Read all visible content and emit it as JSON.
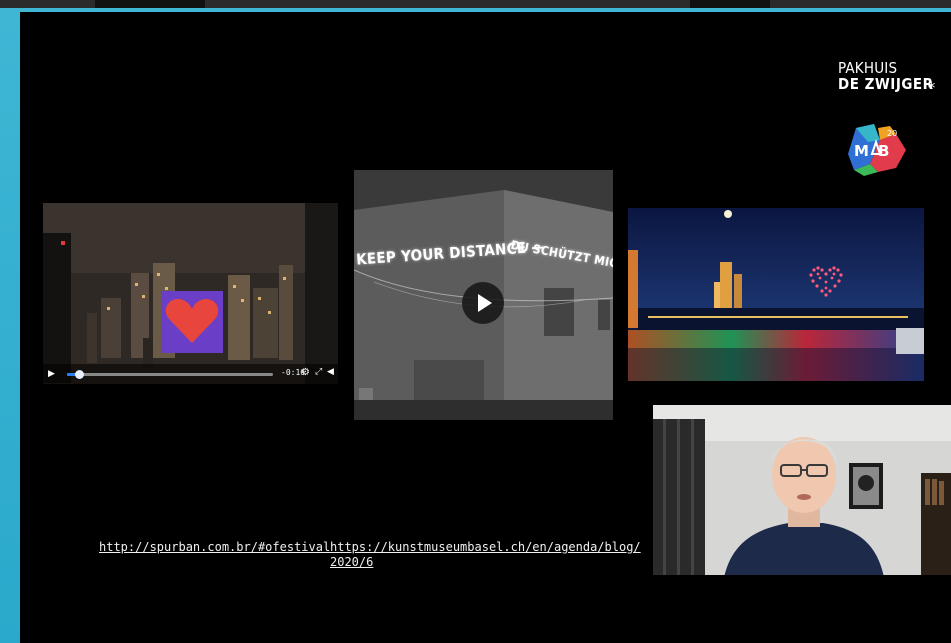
{
  "branding": {
    "org_line1": "PAKHUIS",
    "org_line2": "DE ZWIJGER",
    "org_star": "*",
    "mab_number": "20",
    "mab_letters": "MAB"
  },
  "panels": {
    "heart_video": {
      "icon": "play-icon",
      "time": "-0:16",
      "progress": 0.04
    },
    "projection_video": {
      "sign_left": "KEEP YOUR DISTANCE —",
      "sign_right": "DU SCHÜTZT MICH",
      "icon": "play-icon"
    },
    "drone_heart_photo": {},
    "webcam": {}
  },
  "links": [
    {
      "text": "http://spurban.com.br/#ofestival"
    },
    {
      "text": "https://kunstmuseumbasel.ch/en/agenda/blog/",
      "text2": "2020/6"
    }
  ],
  "colors": {
    "background": "#2aa9cc",
    "slide": "#000000",
    "heart": "#e8463c",
    "progress": "#2d7ff9"
  }
}
